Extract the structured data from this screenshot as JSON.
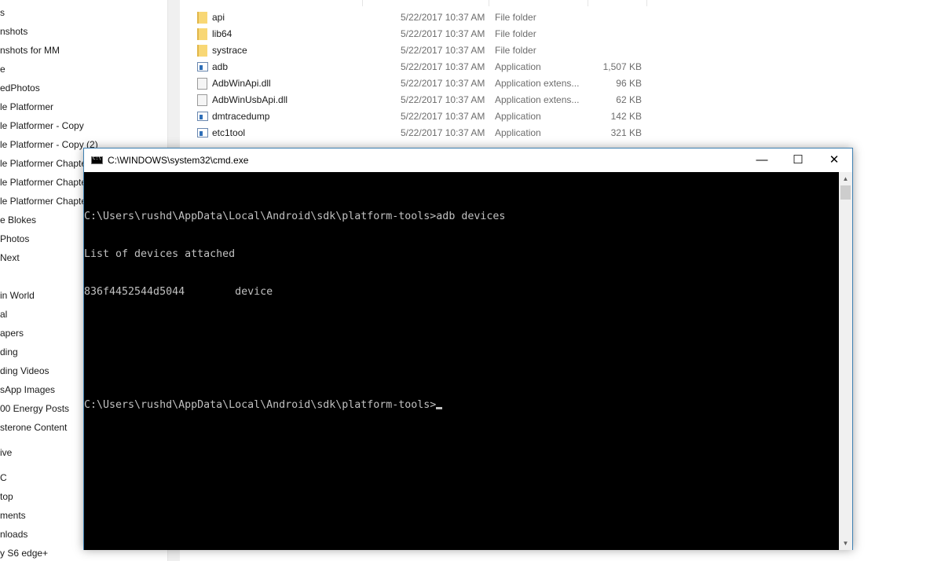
{
  "nav_items": [
    "s",
    "nshots",
    "nshots for MM",
    "e",
    "edPhotos",
    "le Platformer",
    "le Platformer - Copy",
    "le Platformer - Copy (2)",
    "le Platformer Chapte",
    "le Platformer Chapte",
    "le Platformer Chapte",
    "e Blokes",
    "Photos",
    "Next",
    "",
    "in World",
    "al",
    "apers",
    "ding",
    "ding Videos",
    "sApp Images",
    "00 Energy Posts",
    "sterone Content",
    "ive",
    "C",
    "top",
    "ments",
    "nloads",
    "y S6 edge+"
  ],
  "files": [
    {
      "icon": "folder",
      "name": "api",
      "date": "5/22/2017 10:37 AM",
      "type": "File folder",
      "size": ""
    },
    {
      "icon": "folder",
      "name": "lib64",
      "date": "5/22/2017 10:37 AM",
      "type": "File folder",
      "size": ""
    },
    {
      "icon": "folder",
      "name": "systrace",
      "date": "5/22/2017 10:37 AM",
      "type": "File folder",
      "size": ""
    },
    {
      "icon": "app",
      "name": "adb",
      "date": "5/22/2017 10:37 AM",
      "type": "Application",
      "size": "1,507 KB"
    },
    {
      "icon": "dll",
      "name": "AdbWinApi.dll",
      "date": "5/22/2017 10:37 AM",
      "type": "Application extens...",
      "size": "96 KB"
    },
    {
      "icon": "dll",
      "name": "AdbWinUsbApi.dll",
      "date": "5/22/2017 10:37 AM",
      "type": "Application extens...",
      "size": "62 KB"
    },
    {
      "icon": "app",
      "name": "dmtracedump",
      "date": "5/22/2017 10:37 AM",
      "type": "Application",
      "size": "142 KB"
    },
    {
      "icon": "app",
      "name": "etc1tool",
      "date": "5/22/2017 10:37 AM",
      "type": "Application",
      "size": "321 KB"
    }
  ],
  "cmd": {
    "title": "C:\\WINDOWS\\system32\\cmd.exe",
    "minimize": "—",
    "maximize": "☐",
    "close": "✕",
    "lines": [
      "C:\\Users\\rushd\\AppData\\Local\\Android\\sdk\\platform-tools>adb devices",
      "List of devices attached",
      "836f4452544d5044        device",
      "",
      "",
      "C:\\Users\\rushd\\AppData\\Local\\Android\\sdk\\platform-tools>"
    ]
  }
}
